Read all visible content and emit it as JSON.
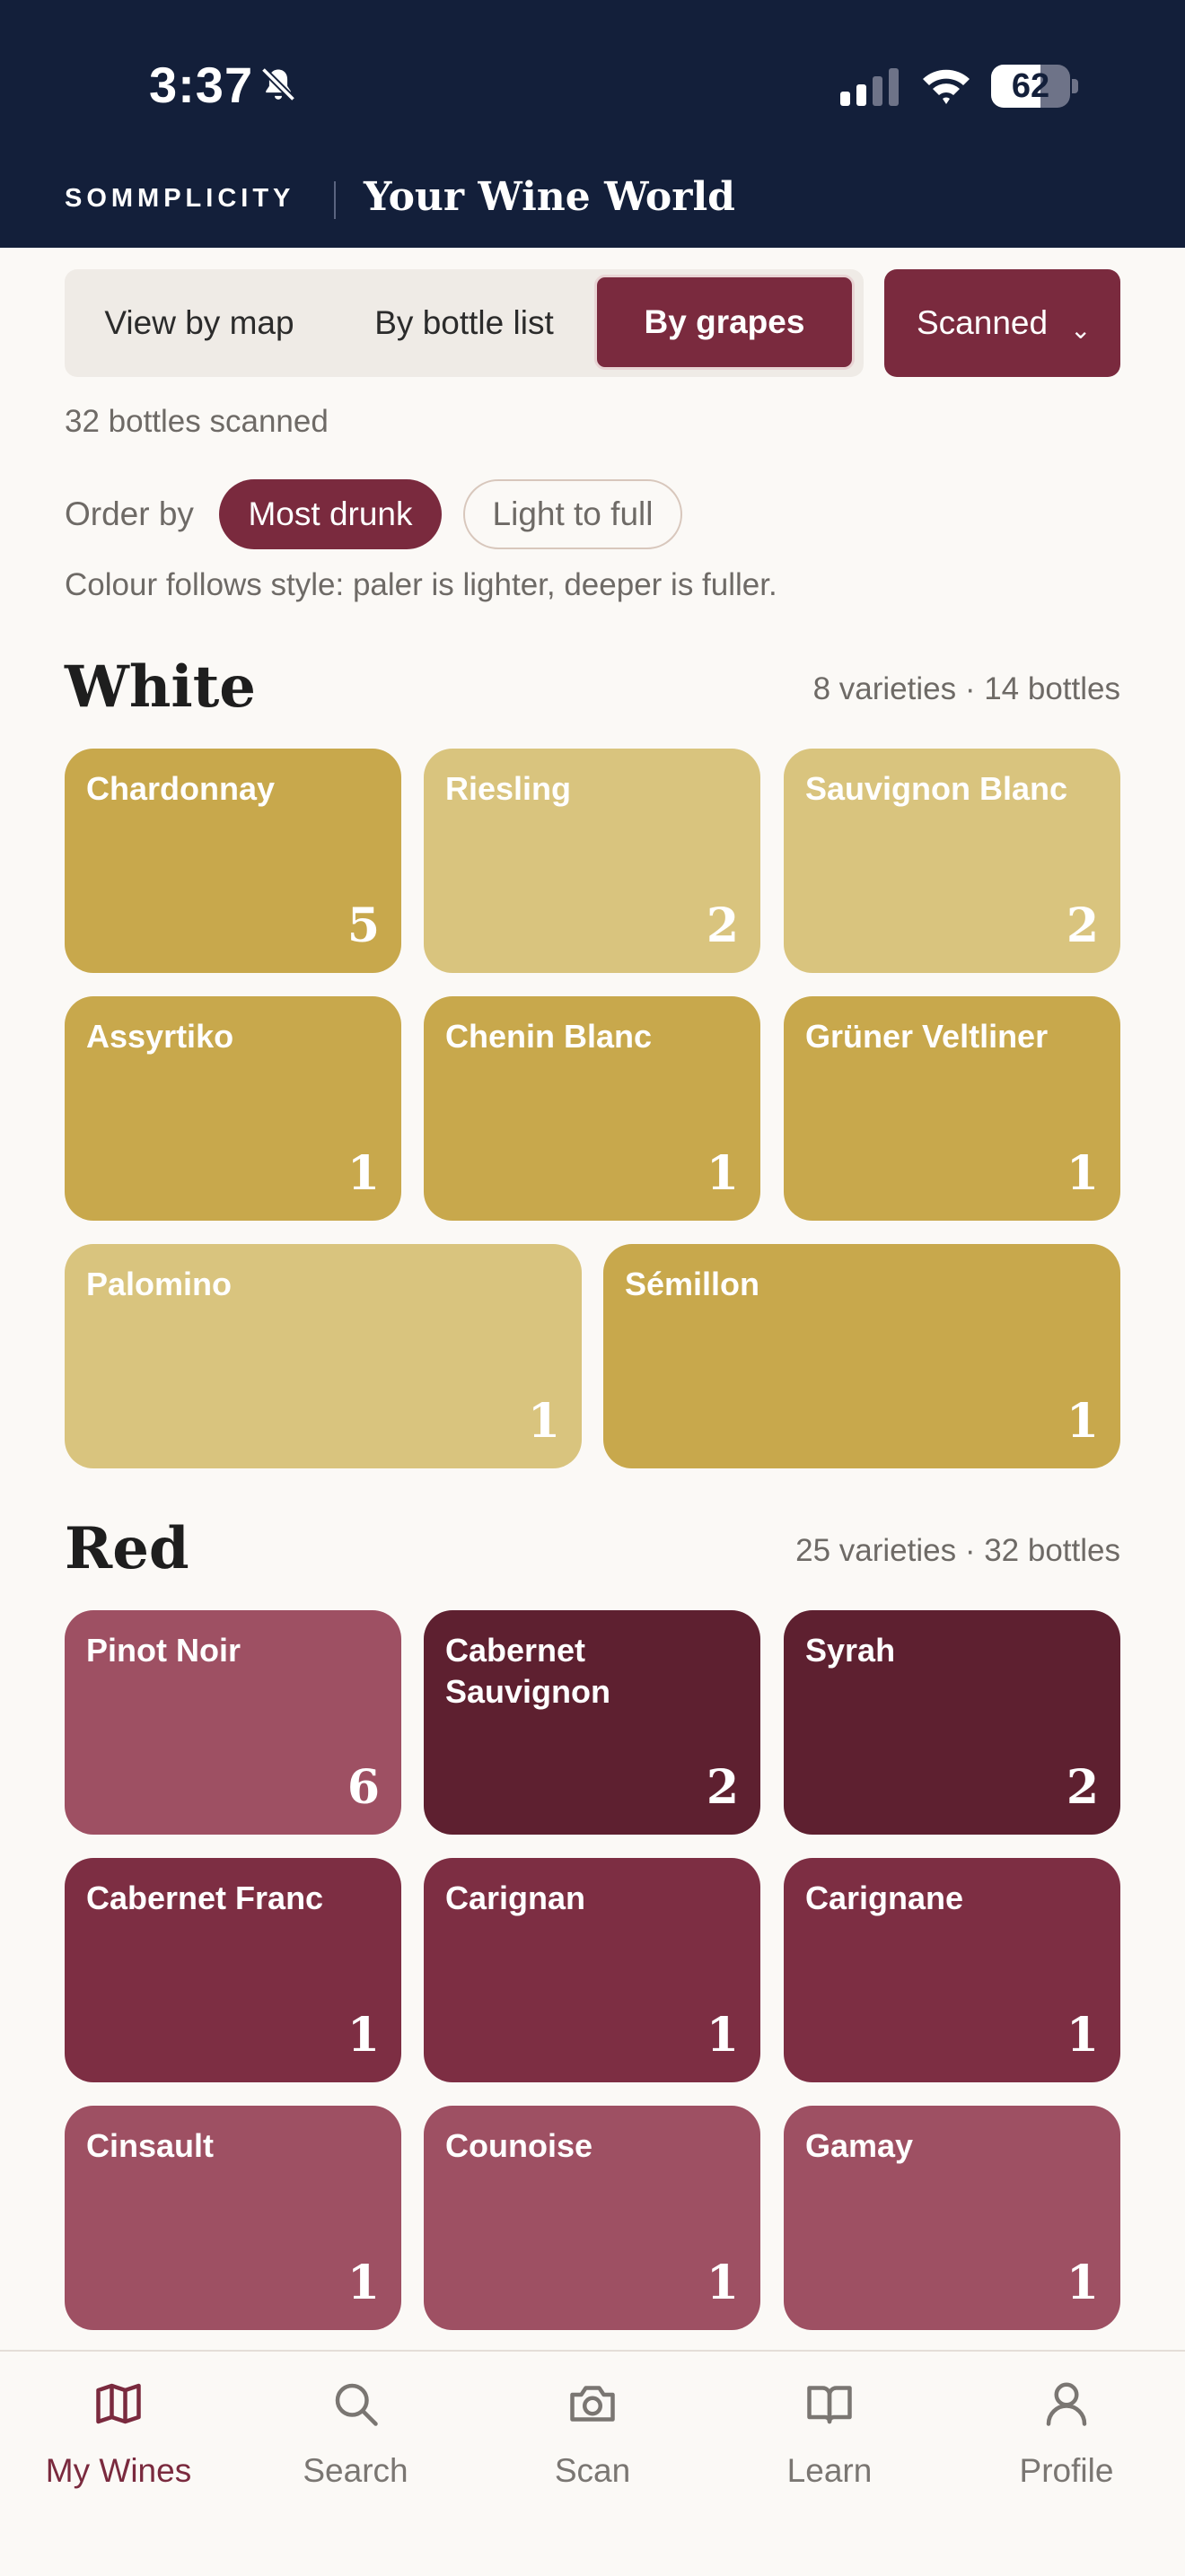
{
  "status_bar": {
    "time": "3:37",
    "battery": "62",
    "battery_level": 0.62
  },
  "header": {
    "brand": "SOMMPLICITY",
    "title": "Your Wine World"
  },
  "view_toggle": {
    "map": "View by map",
    "list": "By bottle list",
    "grapes": "By grapes",
    "active": "By grapes"
  },
  "filter": {
    "label": "Scanned"
  },
  "summary": "32 bottles scanned",
  "order": {
    "label": "Order by",
    "most_drunk": "Most drunk",
    "light_to_full": "Light to full",
    "active": "Most drunk"
  },
  "note": "Colour follows style: paler is lighter, deeper is fuller.",
  "white": {
    "title": "White",
    "stats": "8 varieties  ·  14 bottles",
    "tiles": [
      {
        "name": "Chardonnay",
        "count": "5",
        "color": "#C8A84C"
      },
      {
        "name": "Riesling",
        "count": "2",
        "color": "#D9C47E"
      },
      {
        "name": "Sauvignon Blanc",
        "count": "2",
        "color": "#D9C47E"
      },
      {
        "name": "Assyrtiko",
        "count": "1",
        "color": "#C8A84C"
      },
      {
        "name": "Chenin Blanc",
        "count": "1",
        "color": "#C8A84C"
      },
      {
        "name": "Grüner Veltliner",
        "count": "1",
        "color": "#C8A84C"
      },
      {
        "name": "Palomino",
        "count": "1",
        "color": "#D9C47E"
      },
      {
        "name": "Sémillon",
        "count": "1",
        "color": "#C8A84C"
      }
    ]
  },
  "red": {
    "title": "Red",
    "stats": "25 varieties  ·  32 bottles",
    "tiles": [
      {
        "name": "Pinot Noir",
        "count": "6",
        "color": "#9E5063"
      },
      {
        "name": "Cabernet Sauvignon",
        "count": "2",
        "color": "#5E2030"
      },
      {
        "name": "Syrah",
        "count": "2",
        "color": "#5E2030"
      },
      {
        "name": "Cabernet Franc",
        "count": "1",
        "color": "#7D2E43"
      },
      {
        "name": "Carignan",
        "count": "1",
        "color": "#7D2E43"
      },
      {
        "name": "Carignane",
        "count": "1",
        "color": "#7D2E43"
      },
      {
        "name": "Cinsault",
        "count": "1",
        "color": "#9E5063"
      },
      {
        "name": "Counoise",
        "count": "1",
        "color": "#9E5063"
      },
      {
        "name": "Gamay",
        "count": "1",
        "color": "#9E5063"
      }
    ]
  },
  "tabs": [
    {
      "label": "My Wines",
      "icon": "map-icon",
      "active": true
    },
    {
      "label": "Search",
      "icon": "search-icon",
      "active": false
    },
    {
      "label": "Scan",
      "icon": "camera-icon",
      "active": false
    },
    {
      "label": "Learn",
      "icon": "book-icon",
      "active": false
    },
    {
      "label": "Profile",
      "icon": "person-icon",
      "active": false
    }
  ]
}
